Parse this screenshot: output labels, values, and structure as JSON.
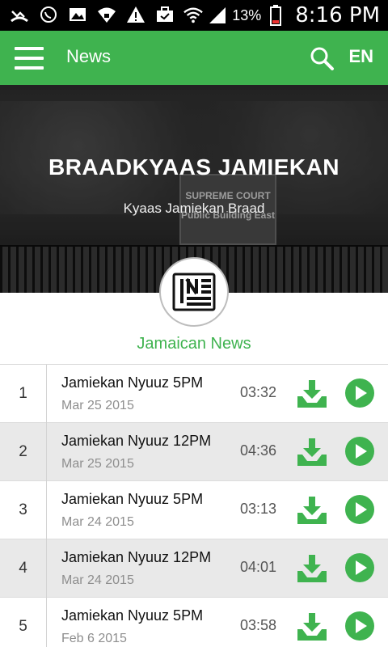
{
  "status_bar": {
    "icons": [
      "missed-call-icon",
      "whatsapp-icon",
      "gallery-icon",
      "wifi-lock-icon",
      "warning-icon",
      "briefcase-check-icon",
      "wifi-icon",
      "signal-icon",
      "battery-icon"
    ],
    "battery_percent": "13%",
    "time": "8:16 PM"
  },
  "app_bar": {
    "title": "News",
    "language": "EN"
  },
  "hero": {
    "headline": "BRAADKYAAS JAMIEKAN",
    "subline": "Kyaas Jamiekan Braad",
    "sign_line_1": "SUPREME COURT",
    "sign_line_2": "Public Building East"
  },
  "category_label": "Jamaican News",
  "colors": {
    "accent": "#3fb34f",
    "alt_row": "#e9e9e9"
  },
  "episodes": [
    {
      "number": "1",
      "title": "Jamiekan Nyuuz 5PM",
      "date": "Mar 25 2015",
      "duration": "03:32"
    },
    {
      "number": "2",
      "title": "Jamiekan Nyuuz 12PM",
      "date": "Mar 25 2015",
      "duration": "04:36"
    },
    {
      "number": "3",
      "title": "Jamiekan Nyuuz 5PM",
      "date": "Mar 24 2015",
      "duration": "03:13"
    },
    {
      "number": "4",
      "title": "Jamiekan Nyuuz 12PM",
      "date": "Mar 24 2015",
      "duration": "04:01"
    },
    {
      "number": "5",
      "title": "Jamiekan Nyuuz 5PM",
      "date": "Feb 6 2015",
      "duration": "03:58"
    }
  ]
}
